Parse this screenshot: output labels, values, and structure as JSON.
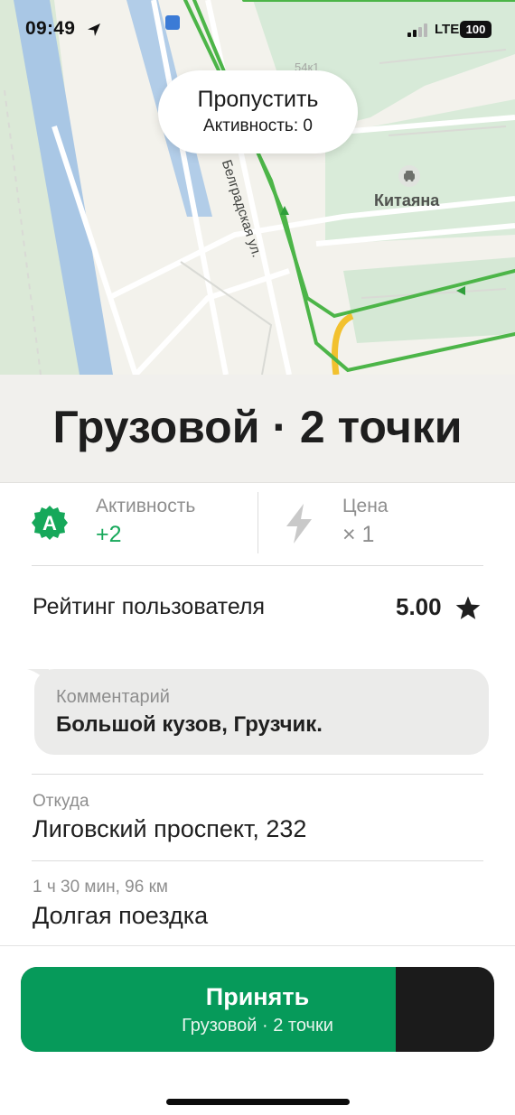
{
  "status_bar": {
    "time": "09:49",
    "network": "LTE",
    "battery": "100"
  },
  "map": {
    "skip_button": {
      "title": "Пропустить",
      "subtitle": "Активность: 0"
    },
    "poi_label": "Китаяна",
    "poi_icon": "car-icon",
    "street_label": "Белградская ул.",
    "house_number": "54к1",
    "route_color": "#4cb548"
  },
  "order": {
    "title": "Грузовой · 2 точки"
  },
  "stats": {
    "activity": {
      "label": "Активность",
      "value": "+2",
      "badge": "A",
      "color": "#16a85a"
    },
    "price": {
      "label": "Цена",
      "value": "× 1",
      "icon": "lightning-icon"
    }
  },
  "rating": {
    "label": "Рейтинг пользователя",
    "value": "5.00",
    "icon": "star-icon"
  },
  "comment": {
    "label": "Комментарий",
    "text": "Большой кузов, Грузчик."
  },
  "from": {
    "label": "Откуда",
    "value": "Лиговский проспект, 232"
  },
  "trip": {
    "label": "1 ч 30 мин, 96 км",
    "value": "Долгая поездка"
  },
  "accept_button": {
    "title": "Принять",
    "subtitle": "Грузовой · 2 точки",
    "accent": "#069a5a"
  }
}
